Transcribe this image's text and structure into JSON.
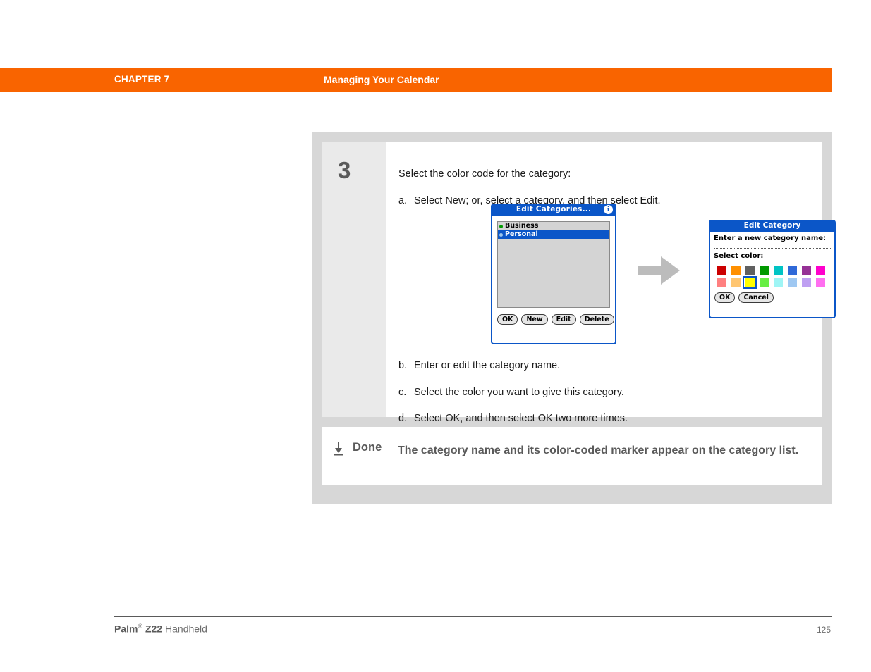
{
  "header": {
    "chapter_label": "CHAPTER 7",
    "chapter_title": "Managing Your Calendar",
    "bar_color": "#f96400"
  },
  "step": {
    "number": "3",
    "lead": "Select the color code for the category:",
    "substeps": [
      {
        "marker": "a.",
        "text": "Select New; or, select a category, and then select Edit."
      },
      {
        "marker": "b.",
        "text": "Enter or edit the category name."
      },
      {
        "marker": "c.",
        "text": "Select the color you want to give this category."
      },
      {
        "marker": "d.",
        "text": "Select OK, and then select OK two more times."
      }
    ]
  },
  "done": {
    "icon": "download-arrow-icon",
    "label": "Done",
    "text": "The category name and its color-coded marker appear on the category list."
  },
  "dialogs": {
    "edit_categories": {
      "title": "Edit Categories...",
      "info_icon": "info-icon",
      "items": [
        {
          "name": "Business",
          "dot_color": "#009900",
          "selected": false
        },
        {
          "name": "Personal",
          "dot_color": "#9ec6ea",
          "selected": true
        }
      ],
      "buttons": [
        "OK",
        "New",
        "Edit",
        "Delete"
      ]
    },
    "edit_category": {
      "title": "Edit Category",
      "prompt": "Enter a new category name:",
      "name_value": "",
      "select_color_label": "Select color:",
      "swatches_row1": [
        "#cc0000",
        "#ff9000",
        "#606060",
        "#009900",
        "#00c4c4",
        "#2f69d8",
        "#963296",
        "#ff00cc"
      ],
      "swatches_row2": [
        "#ff8080",
        "#ffc671",
        "#ffff00",
        "#66ee44",
        "#9ff5f5",
        "#9fc8f2",
        "#bf9ff2",
        "#ff6ef0"
      ],
      "selected_swatch_index": 2,
      "selected_swatch_row": 2,
      "buttons": [
        "OK",
        "Cancel"
      ]
    }
  },
  "arrow": {
    "name": "right-arrow-icon",
    "color": "#bcbcbc"
  },
  "footer": {
    "product_bold": "Palm",
    "product_sup": "®",
    "product_model": "Z22",
    "product_suffix": " Handheld",
    "page_number": "125"
  }
}
